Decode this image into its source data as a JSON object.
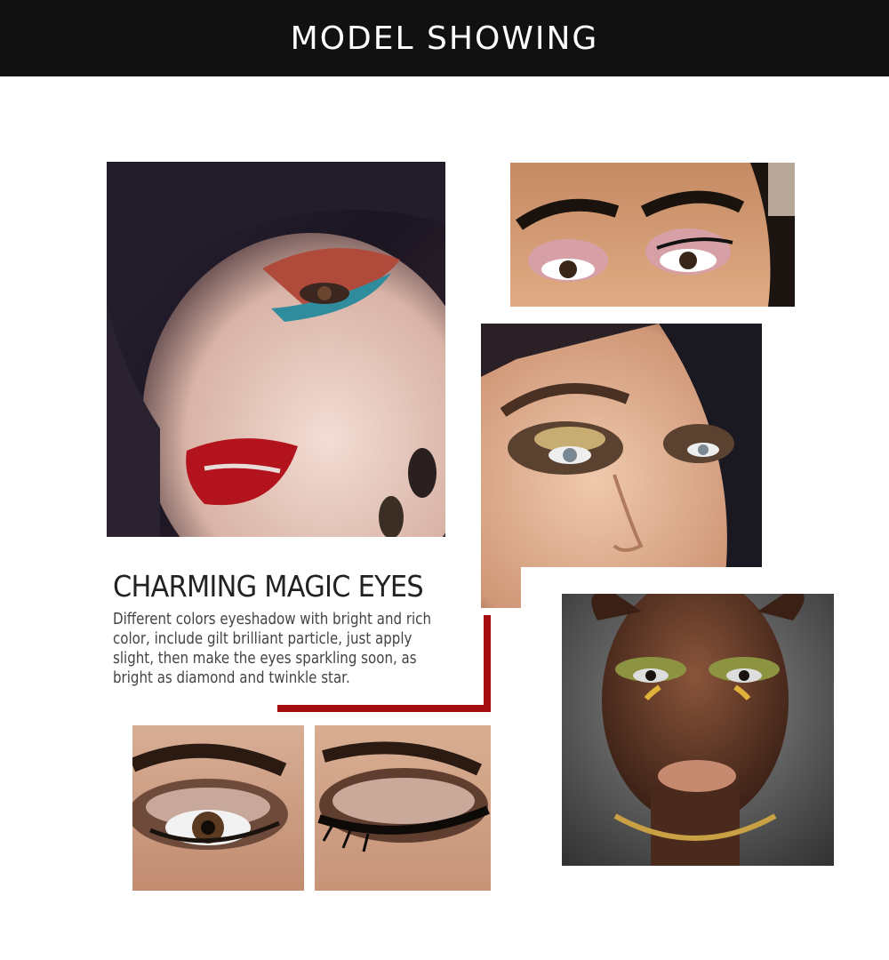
{
  "banner": {
    "title": "MODEL SHOWING"
  },
  "feature": {
    "headline": "CHARMING MAGIC EYES",
    "description": "Different colors eyeshadow with bright and rich color, include gilt brilliant particle, just apply slight, then make the eyes sparkling soon, as bright as diamond and twinkle star."
  },
  "colors": {
    "banner_bg": "#111111",
    "accent_red": "#a50d10",
    "page_bg": "#ffffff"
  }
}
